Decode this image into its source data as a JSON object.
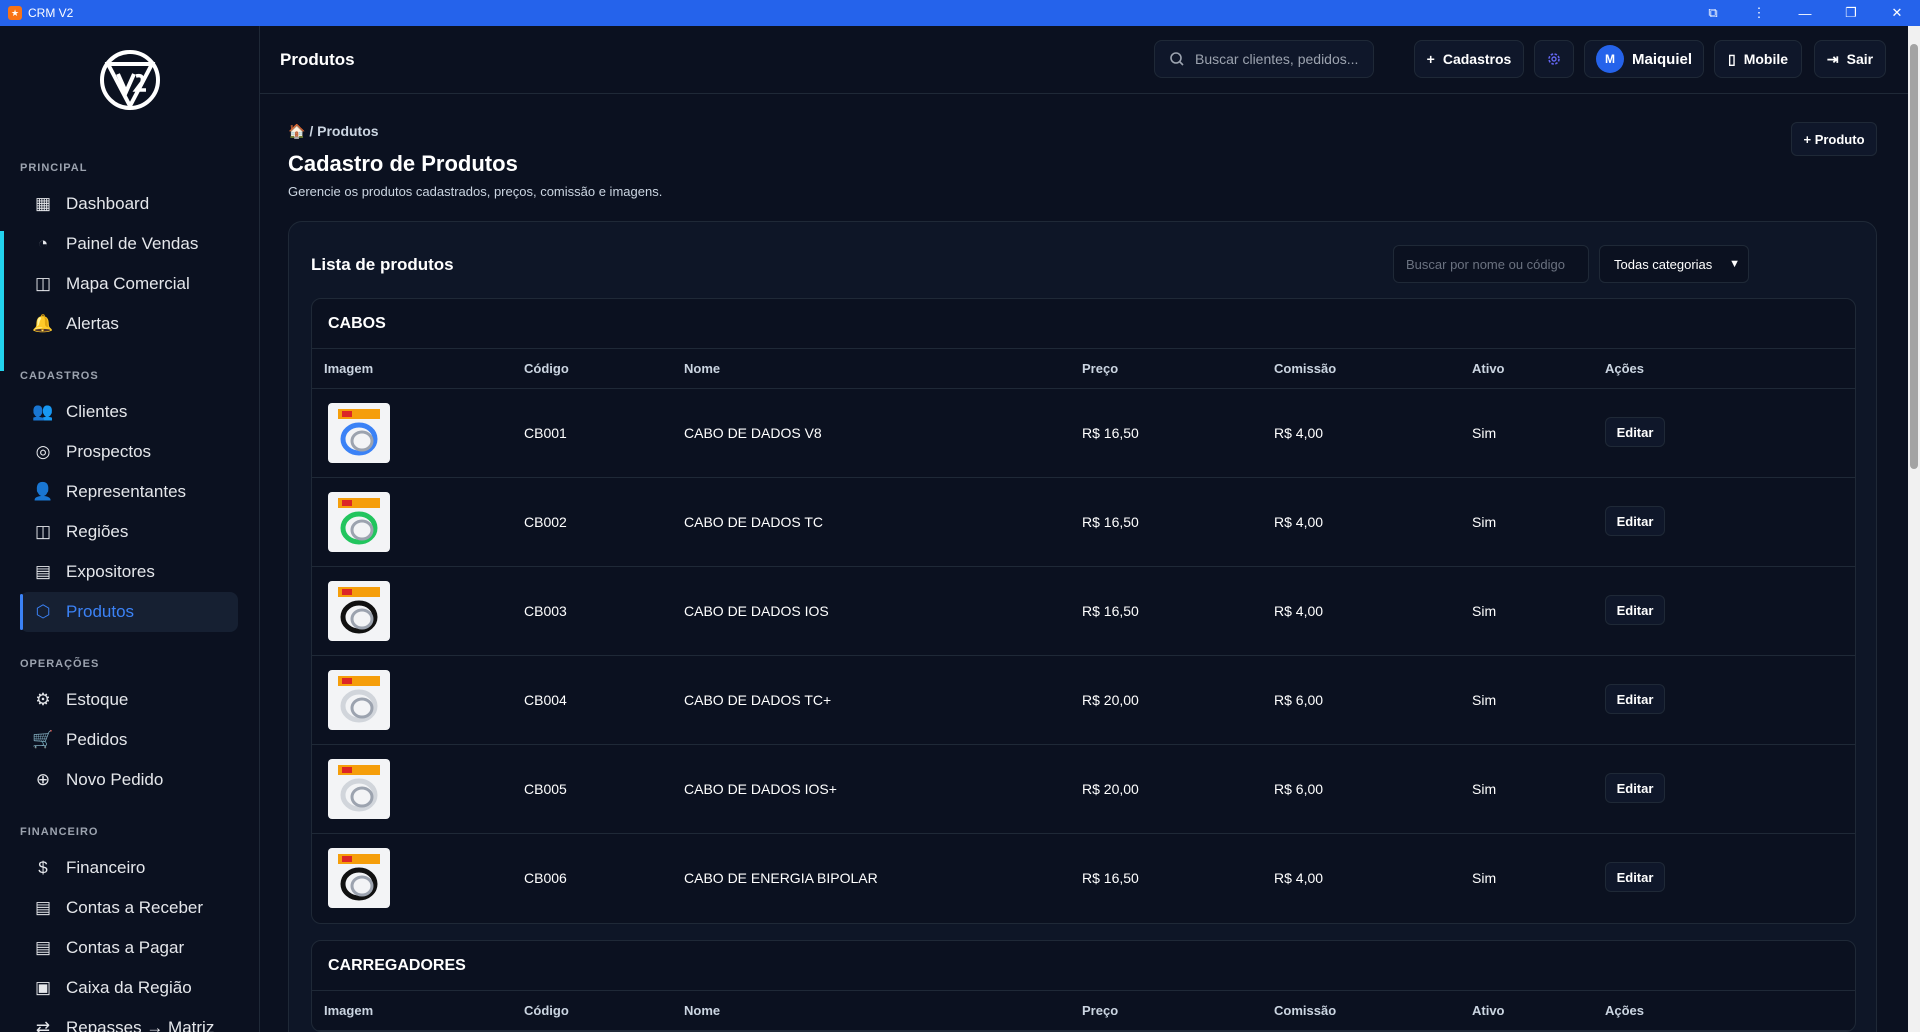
{
  "window": {
    "title": "CRM V2"
  },
  "sidebar": {
    "sections": [
      {
        "label": "PRINCIPAL",
        "items": [
          "Dashboard",
          "Painel de Vendas",
          "Mapa Comercial",
          "Alertas"
        ]
      },
      {
        "label": "CADASTROS",
        "items": [
          "Clientes",
          "Prospectos",
          "Representantes",
          "Regiões",
          "Expositores",
          "Produtos"
        ]
      },
      {
        "label": "OPERAÇÕES",
        "items": [
          "Estoque",
          "Pedidos",
          "Novo Pedido"
        ]
      },
      {
        "label": "FINANCEIRO",
        "items": [
          "Financeiro",
          "Contas a Receber",
          "Contas a Pagar",
          "Caixa da Região",
          "Repasses → Matriz"
        ]
      }
    ],
    "active_item": "Produtos",
    "accent_color": "#3b82f6"
  },
  "header": {
    "title": "Produtos",
    "search_placeholder": "Buscar clientes, pedidos...",
    "cadastros_label": "Cadastros",
    "user_initial": "M",
    "user_name": "Maiquiel",
    "mobile_label": "Mobile",
    "logout_label": "Sair"
  },
  "page": {
    "breadcrumb": "/ Produtos",
    "title": "Cadastro de Produtos",
    "subtitle": "Gerencie os produtos cadastrados, preços, comissão e imagens.",
    "add_button": "+ Produto"
  },
  "list": {
    "title": "Lista de produtos",
    "search_placeholder": "Buscar por nome ou código",
    "category_selected": "Todas categorias",
    "columns": [
      "Imagem",
      "Código",
      "Nome",
      "Preço",
      "Comissão",
      "Ativo",
      "Ações"
    ],
    "edit_label": "Editar",
    "groups": [
      {
        "name": "CABOS",
        "rows": [
          {
            "code": "CB001",
            "name": "CABO DE DADOS V8",
            "price": "R$ 16,50",
            "commission": "R$ 4,00",
            "active": "Sim",
            "thumb_color": "#3b82f6"
          },
          {
            "code": "CB002",
            "name": "CABO DE DADOS TC",
            "price": "R$ 16,50",
            "commission": "R$ 4,00",
            "active": "Sim",
            "thumb_color": "#22c55e"
          },
          {
            "code": "CB003",
            "name": "CABO DE DADOS IOS",
            "price": "R$ 16,50",
            "commission": "R$ 4,00",
            "active": "Sim",
            "thumb_color": "#111111"
          },
          {
            "code": "CB004",
            "name": "CABO DE DADOS TC+",
            "price": "R$ 20,00",
            "commission": "R$ 6,00",
            "active": "Sim",
            "thumb_color": "#d1d5db"
          },
          {
            "code": "CB005",
            "name": "CABO DE DADOS IOS+",
            "price": "R$ 20,00",
            "commission": "R$ 6,00",
            "active": "Sim",
            "thumb_color": "#d1d5db"
          },
          {
            "code": "CB006",
            "name": "CABO DE ENERGIA BIPOLAR",
            "price": "R$ 16,50",
            "commission": "R$ 4,00",
            "active": "Sim",
            "thumb_color": "#111111"
          }
        ]
      },
      {
        "name": "CARREGADORES",
        "rows": []
      }
    ]
  }
}
